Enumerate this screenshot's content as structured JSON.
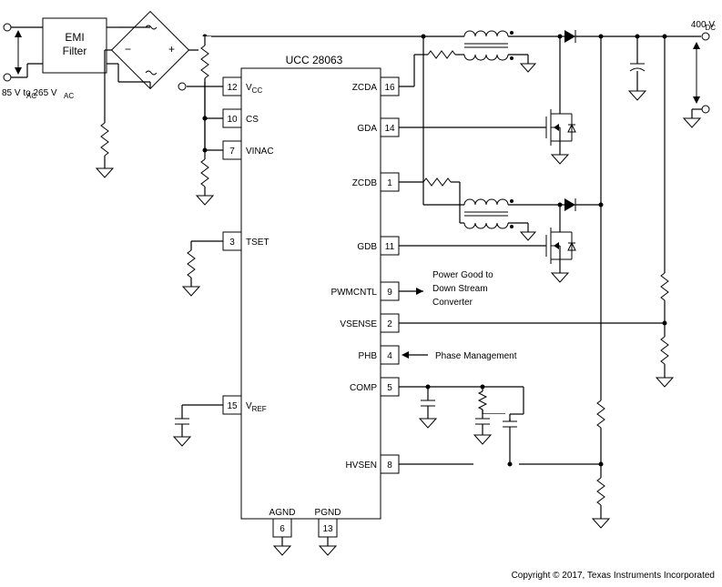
{
  "chip_name": "UCC 28063",
  "input_label": "85 V   to 265 V",
  "input_sub1": "AC",
  "input_sub2": "AC",
  "output_label": "400 V",
  "output_sub": "DC",
  "emi_label": "EMI",
  "emi_label2": "Filter",
  "pwmcntl_note1": "Power Good to",
  "pwmcntl_note2": "Down Stream",
  "pwmcntl_note3": "Converter",
  "phb_note": "Phase Management",
  "copyright": "Copyright © 2017, Texas Instruments Incorporated",
  "pins_left": [
    {
      "num": "12",
      "name": "V",
      "sub": "CC"
    },
    {
      "num": "10",
      "name": "CS"
    },
    {
      "num": "7",
      "name": "VINAC"
    },
    {
      "num": "3",
      "name": "TSET"
    },
    {
      "num": "15",
      "name": "V",
      "sub": "REF"
    }
  ],
  "pins_right": [
    {
      "num": "16",
      "name": "ZCDA"
    },
    {
      "num": "14",
      "name": "GDA"
    },
    {
      "num": "1",
      "name": "ZCDB"
    },
    {
      "num": "11",
      "name": "GDB"
    },
    {
      "num": "9",
      "name": "PWMCNTL"
    },
    {
      "num": "2",
      "name": "VSENSE"
    },
    {
      "num": "4",
      "name": "PHB"
    },
    {
      "num": "5",
      "name": "COMP"
    },
    {
      "num": "8",
      "name": "HVSEN"
    }
  ],
  "pins_bottom": [
    {
      "num": "6",
      "name": "AGND"
    },
    {
      "num": "13",
      "name": "PGND"
    }
  ]
}
